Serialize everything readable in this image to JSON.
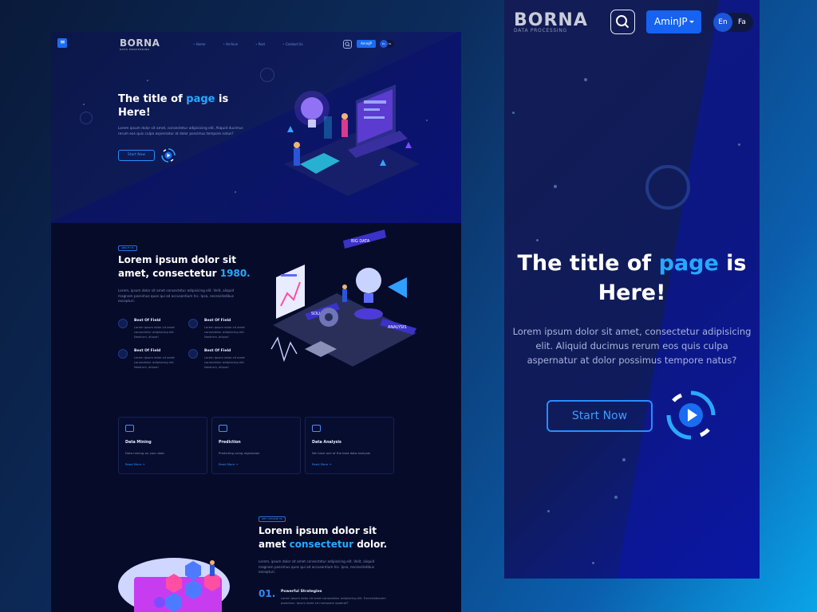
{
  "desktop": {
    "brand": {
      "logo": "BORNA",
      "tagline": "DATA PROCESSING"
    },
    "nav": {
      "links": [
        "Home",
        "Archive",
        "Post",
        "Contact Us"
      ],
      "user_label": "AminJP",
      "lang_active": "En",
      "lang_other": "Fa"
    },
    "hero": {
      "title_a": "The title of ",
      "title_accent": "page",
      "title_b": " is Here!",
      "desc": "Lorem ipsum dolor sit amet, consectetur adipisicing elit. Aliquid ducimus rerum eos quis culpa aspernatur at dolor possimus tempore natus?",
      "start": "Start Now"
    },
    "about": {
      "tag": "ABOUT US",
      "title_a": "Lorem ipsum dolor sit amet, consectetur ",
      "title_accent": "1980.",
      "desc": "Lorem, ipsum dolor sit amet consectetur adipisicing elit. Velit, aliquid magnam possimus quos qui ad accusantium hic. Ipsa, necessitatibus excepturi.",
      "features": [
        {
          "title": "Best Of Field",
          "desc": "Lorem ipsum dolor sit amet consectetur adipisicing elit. Nostrum, aliqua!"
        },
        {
          "title": "Best Of Field",
          "desc": "Lorem ipsum dolor sit amet consectetur adipisicing elit. Nostrum, aliqua!"
        },
        {
          "title": "Best Of Field",
          "desc": "Lorem ipsum dolor sit amet consectetur adipisicing elit. Nostrum, aliqua!"
        },
        {
          "title": "Best Of Field",
          "desc": "Lorem ipsum dolor sit amet consectetur adipisicing elit. Nostrum, aliqua!"
        }
      ],
      "illu_labels": [
        "BIG DATA",
        "SOLUTION",
        "ANALYSIS"
      ]
    },
    "services": [
      {
        "title": "Data Mining",
        "desc": "Data mining on your data",
        "link": "Read More →"
      },
      {
        "title": "Prediction",
        "desc": "Predicting using regression",
        "link": "Read More →"
      },
      {
        "title": "Data Analysis",
        "desc": "We have one of the best data analysts",
        "link": "Read More →"
      }
    ],
    "why": {
      "tag": "WHY CHOOSE US",
      "title_a": "Lorem ipsum dolor sit amet ",
      "title_accent": "consectetur",
      "title_b": " dolor.",
      "desc": "Lorem, ipsum dolor sit amet consectetur adipisicing elit. Velit, aliquid magnam possimus quos qui ad accusantium hic. Ipsa, necessitatibus excepturi.",
      "item_num": "01.",
      "item_title": "Powerful Strategies",
      "item_desc": "Lorem ipsum dolor sit amet consectetur adipisicing elit. Exercitationem possimus. Ipsum dolor sit numquam quaerat?"
    }
  },
  "mobile": {
    "brand": {
      "logo": "BORNA",
      "tagline": "DATA PROCESSING"
    },
    "user_label": "AminJP",
    "lang_active": "En",
    "lang_other": "Fa",
    "hero": {
      "title_a": "The title of ",
      "title_accent": "page",
      "title_b": " is Here!",
      "desc": "Lorem ipsum dolor sit amet, consectetur adipisicing elit. Aliquid ducimus rerum eos quis culpa aspernatur at dolor possimus tempore natus?",
      "start": "Start Now"
    }
  },
  "colors": {
    "accent": "#27a8ff",
    "primary_button": "#1563f0",
    "background": "#060b2a"
  }
}
